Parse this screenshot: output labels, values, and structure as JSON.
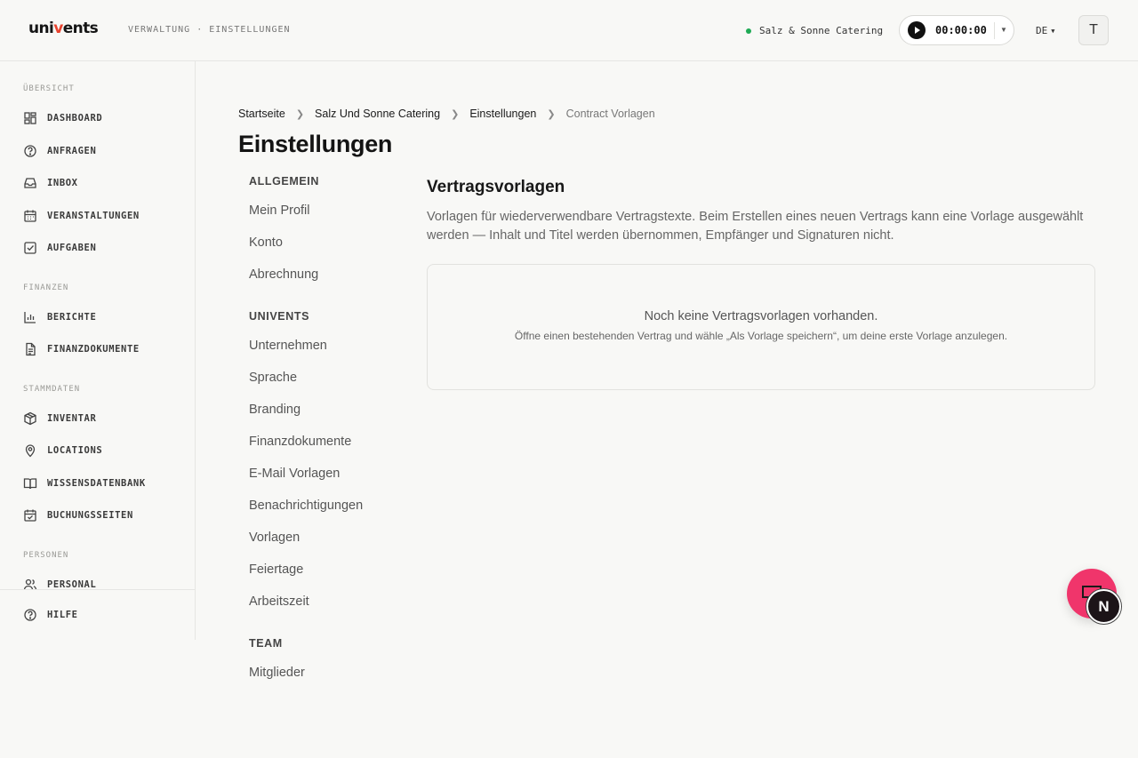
{
  "header": {
    "logo_prefix": "uni",
    "logo_v": "v",
    "logo_suffix": "ents",
    "context": "VERWALTUNG · EINSTELLUNGEN",
    "org_name": "Salz & Sonne Catering",
    "timer_value": "00:00:00",
    "language": "DE",
    "avatar_initial": "T"
  },
  "sidebar": {
    "sections": [
      {
        "label": "ÜBERSICHT",
        "items": [
          "DASHBOARD",
          "ANFRAGEN",
          "INBOX",
          "VERANSTALTUNGEN",
          "AUFGABEN"
        ]
      },
      {
        "label": "FINANZEN",
        "items": [
          "BERICHTE",
          "FINANZDOKUMENTE"
        ]
      },
      {
        "label": "STAMMDATEN",
        "items": [
          "INVENTAR",
          "LOCATIONS",
          "WISSENSDATENBANK",
          "BUCHUNGSSEITEN"
        ]
      },
      {
        "label": "PERSONEN",
        "items": [
          "PERSONAL"
        ]
      }
    ],
    "footer_item": "HILFE"
  },
  "breadcrumb": [
    "Startseite",
    "Salz Und Sonne Catering",
    "Einstellungen",
    "Contract Vorlagen"
  ],
  "page_title": "Einstellungen",
  "settings_nav": {
    "groups": [
      {
        "label": "ALLGEMEIN",
        "items": [
          "Mein Profil",
          "Konto",
          "Abrechnung"
        ]
      },
      {
        "label": "UNIVENTS",
        "items": [
          "Unternehmen",
          "Sprache",
          "Branding",
          "Finanzdokumente",
          "E-Mail Vorlagen",
          "Benachrichtigungen",
          "Vorlagen",
          "Feiertage",
          "Arbeitszeit"
        ]
      },
      {
        "label": "TEAM",
        "items": [
          "Mitglieder"
        ]
      }
    ]
  },
  "content": {
    "title": "Vertragsvorlagen",
    "description": "Vorlagen für wiederverwendbare Vertragstexte. Beim Erstellen eines neuen Vertrags kann eine Vorlage ausgewählt werden — Inhalt und Titel werden übernommen, Empfänger und Signaturen nicht.",
    "empty_title": "Noch keine Vertragsvorlagen vorhanden.",
    "empty_hint": "Öffne einen bestehenden Vertrag und wähle „Als Vorlage speichern“, um deine erste Vorlage anzulegen."
  },
  "widgets": {
    "badge_letter": "N",
    "accent": "#f0356b",
    "status_color": "#1faa55"
  }
}
